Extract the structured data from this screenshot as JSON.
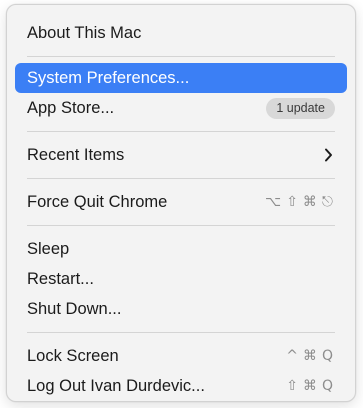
{
  "menu": {
    "about": {
      "label": "About This Mac"
    },
    "system_preferences": {
      "label": "System Preferences..."
    },
    "app_store": {
      "label": "App Store...",
      "badge": "1 update"
    },
    "recent_items": {
      "label": "Recent Items",
      "submenu_icon": "chevron-right-icon"
    },
    "force_quit": {
      "label": "Force Quit Chrome",
      "shortcut_keys": [
        "⌥",
        "⇧",
        "⌘",
        "⎋"
      ]
    },
    "sleep": {
      "label": "Sleep"
    },
    "restart": {
      "label": "Restart..."
    },
    "shut_down": {
      "label": "Shut Down..."
    },
    "lock_screen": {
      "label": "Lock Screen",
      "shortcut_keys": [
        "^",
        "⌘",
        "Q"
      ]
    },
    "log_out": {
      "label": "Log Out Ivan Durdevic...",
      "shortcut_keys": [
        "⇧",
        "⌘",
        "Q"
      ]
    }
  },
  "colors": {
    "highlight": "#3b7ff5",
    "menu_background": "#f3f3f3",
    "badge_background": "#d8d8d8",
    "shortcut_text": "#8d8d8d"
  }
}
